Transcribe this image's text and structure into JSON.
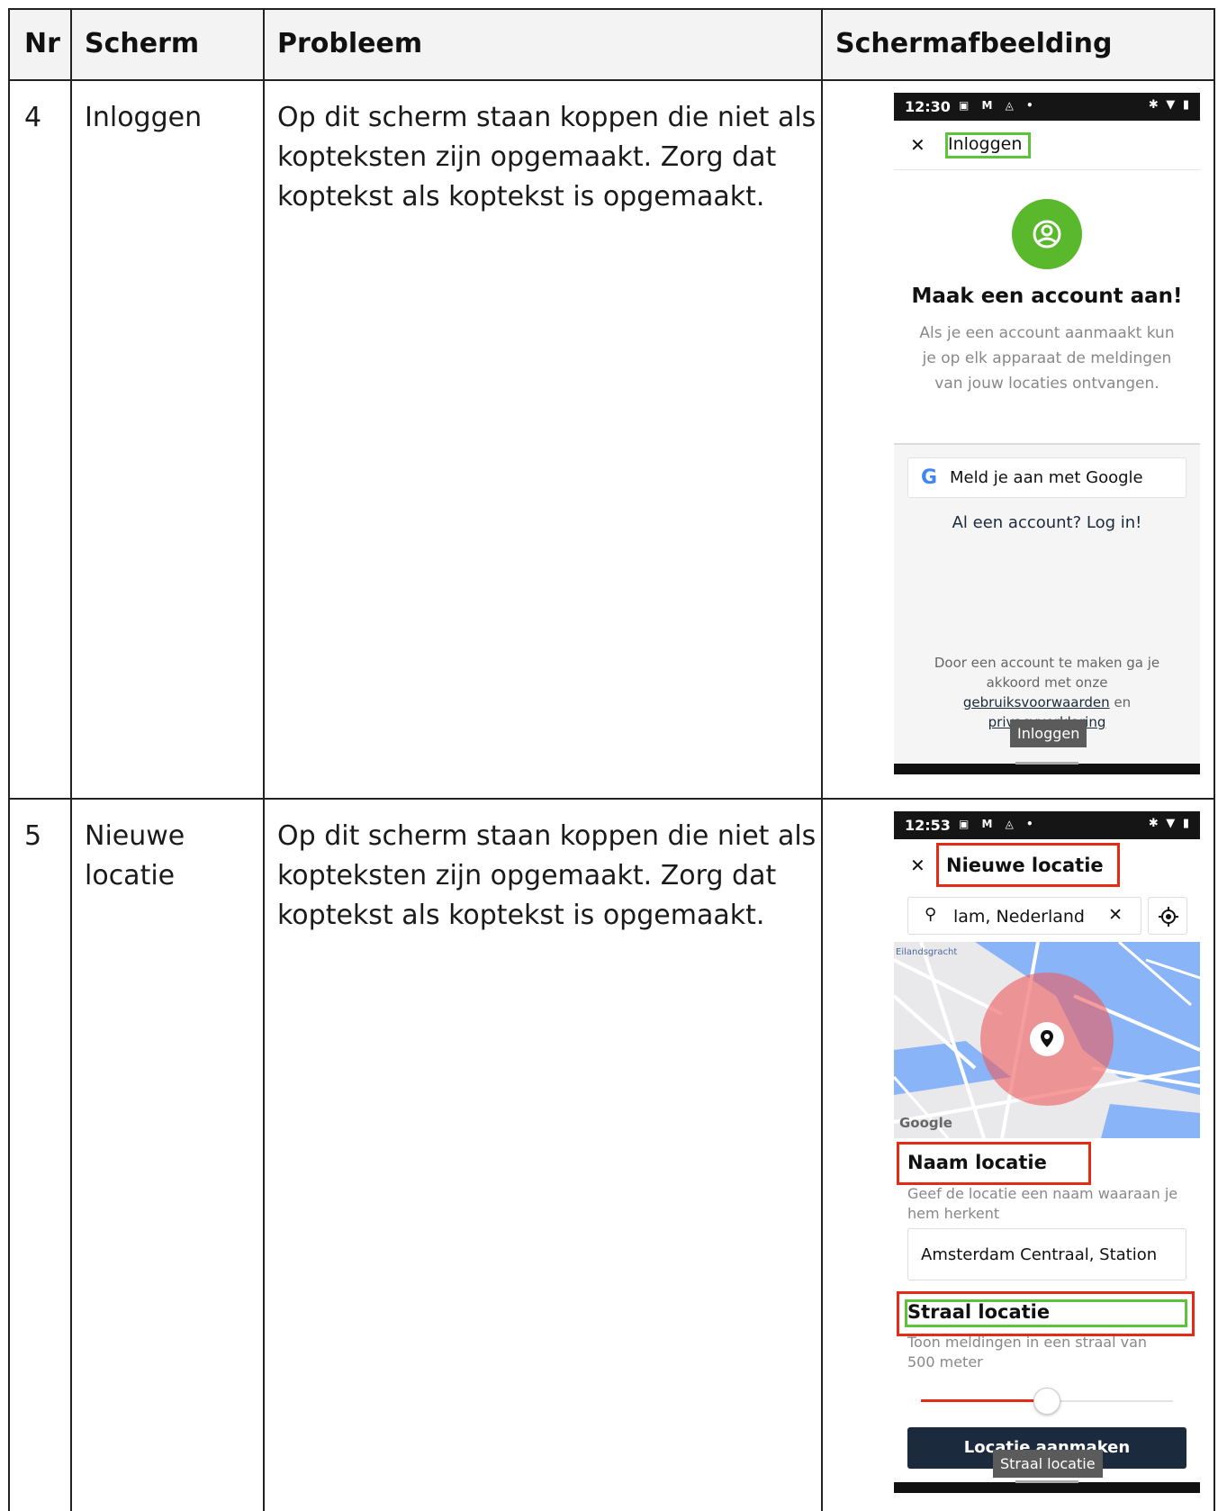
{
  "table": {
    "headers": [
      "Nr",
      "Scherm",
      "Probleem",
      "Schermafbeelding"
    ],
    "rows": [
      {
        "nr": "4",
        "scherm": "Inloggen",
        "probleem": "Op dit scherm staan koppen die niet als kopteksten zijn opgemaakt. Zorg dat koptekst als koptekst is opgemaakt."
      },
      {
        "nr": "5",
        "scherm": "Nieuwe locatie",
        "probleem": "Op dit scherm staan koppen die niet als kopteksten zijn opgemaakt. Zorg dat koptekst als koptekst is opgemaakt."
      }
    ]
  },
  "screen1": {
    "time": "12:30",
    "title": "Inloggen",
    "heading": "Maak een account aan!",
    "description": "Als je een account aanmaakt kun je op elk apparaat de meldingen van jouw locaties ontvangen.",
    "google_button": "Meld je aan met Google",
    "login_link": "Al een account? Log in!",
    "terms_prefix": "Door een account te maken ga je akkoord met onze",
    "terms_link": "gebruiksvoorwaarden",
    "terms_and": "en",
    "privacy_link": "privacyverklaring",
    "tooltip": "Inloggen",
    "accent_color": "#5ab82c"
  },
  "screen2": {
    "time": "12:53",
    "title": "Nieuwe locatie",
    "search_value": "lam, Nederland",
    "map_label": "Eilandsgracht",
    "map_brand": "Google",
    "name_heading": "Naam locatie",
    "name_hint": "Geef de locatie een naam waaraan je hem herkent",
    "name_value": "Amsterdam Centraal, Station",
    "radius_heading": "Straal locatie",
    "radius_hint": "Toon meldingen in een straal van 500 meter",
    "slider_value": 0.5,
    "create_button": "Locatie aanmaken",
    "tooltip": "Straal locatie",
    "button_color": "#1b2a3c",
    "highlight_red": "#e52b13",
    "highlight_green": "#5cc43a"
  }
}
